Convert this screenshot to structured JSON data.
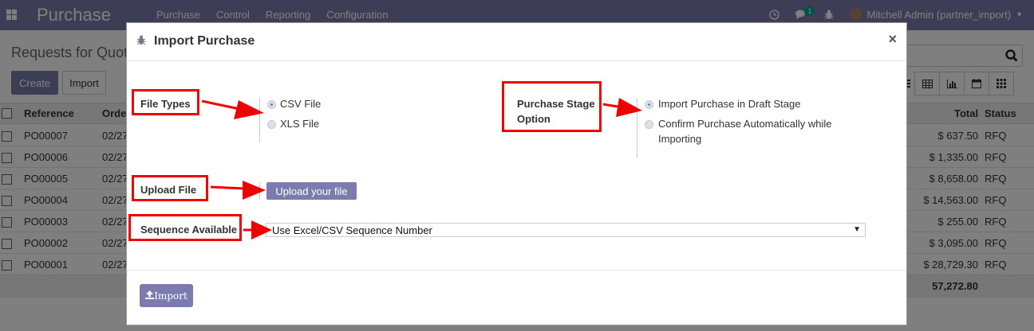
{
  "navbar": {
    "brand": "Purchase",
    "menu": [
      "Purchase",
      "Control",
      "Reporting",
      "Configuration"
    ],
    "chat_badge": "1",
    "user": "Mitchell Admin (partner_import)"
  },
  "control_panel": {
    "breadcrumb": "Requests for Quot",
    "create_label": "Create",
    "import_label": "Import"
  },
  "list": {
    "headers": {
      "reference": "Reference",
      "order": "Orde",
      "total": "Total",
      "status": "Status"
    },
    "rows": [
      {
        "ref": "PO00007",
        "order": "02/27",
        "total": "$ 637.50",
        "status": "RFQ"
      },
      {
        "ref": "PO00006",
        "order": "02/27",
        "total": "$ 1,335.00",
        "status": "RFQ"
      },
      {
        "ref": "PO00005",
        "order": "02/27",
        "total": "$ 8,658.00",
        "status": "RFQ"
      },
      {
        "ref": "PO00004",
        "order": "02/27",
        "total": "$ 14,563.00",
        "status": "RFQ"
      },
      {
        "ref": "PO00003",
        "order": "02/27",
        "total": "$ 255.00",
        "status": "RFQ"
      },
      {
        "ref": "PO00002",
        "order": "02/27",
        "total": "$ 3,095.00",
        "status": "RFQ"
      },
      {
        "ref": "PO00001",
        "order": "02/27",
        "total": "$ 28,729.30",
        "status": "RFQ"
      }
    ],
    "sum_total": "57,272.80"
  },
  "modal": {
    "title": "Import Purchase",
    "close_glyph": "×",
    "file_types": {
      "label": "File Types",
      "options": [
        "CSV File",
        "XLS File"
      ]
    },
    "stage": {
      "label_line1": "Purchase Stage",
      "label_line2": "Option",
      "option1": "Import Purchase in Draft Stage",
      "option2_line1": "Confirm Purchase Automatically while",
      "option2_line2": "Importing"
    },
    "upload": {
      "label": "Upload File",
      "button": "Upload your file"
    },
    "sequence": {
      "label": "Sequence Available",
      "selected": "Use Excel/CSV Sequence Number"
    },
    "import_button": "Import"
  },
  "colors": {
    "brand": "#7c7bad",
    "annotation_red": "#ee0000"
  }
}
